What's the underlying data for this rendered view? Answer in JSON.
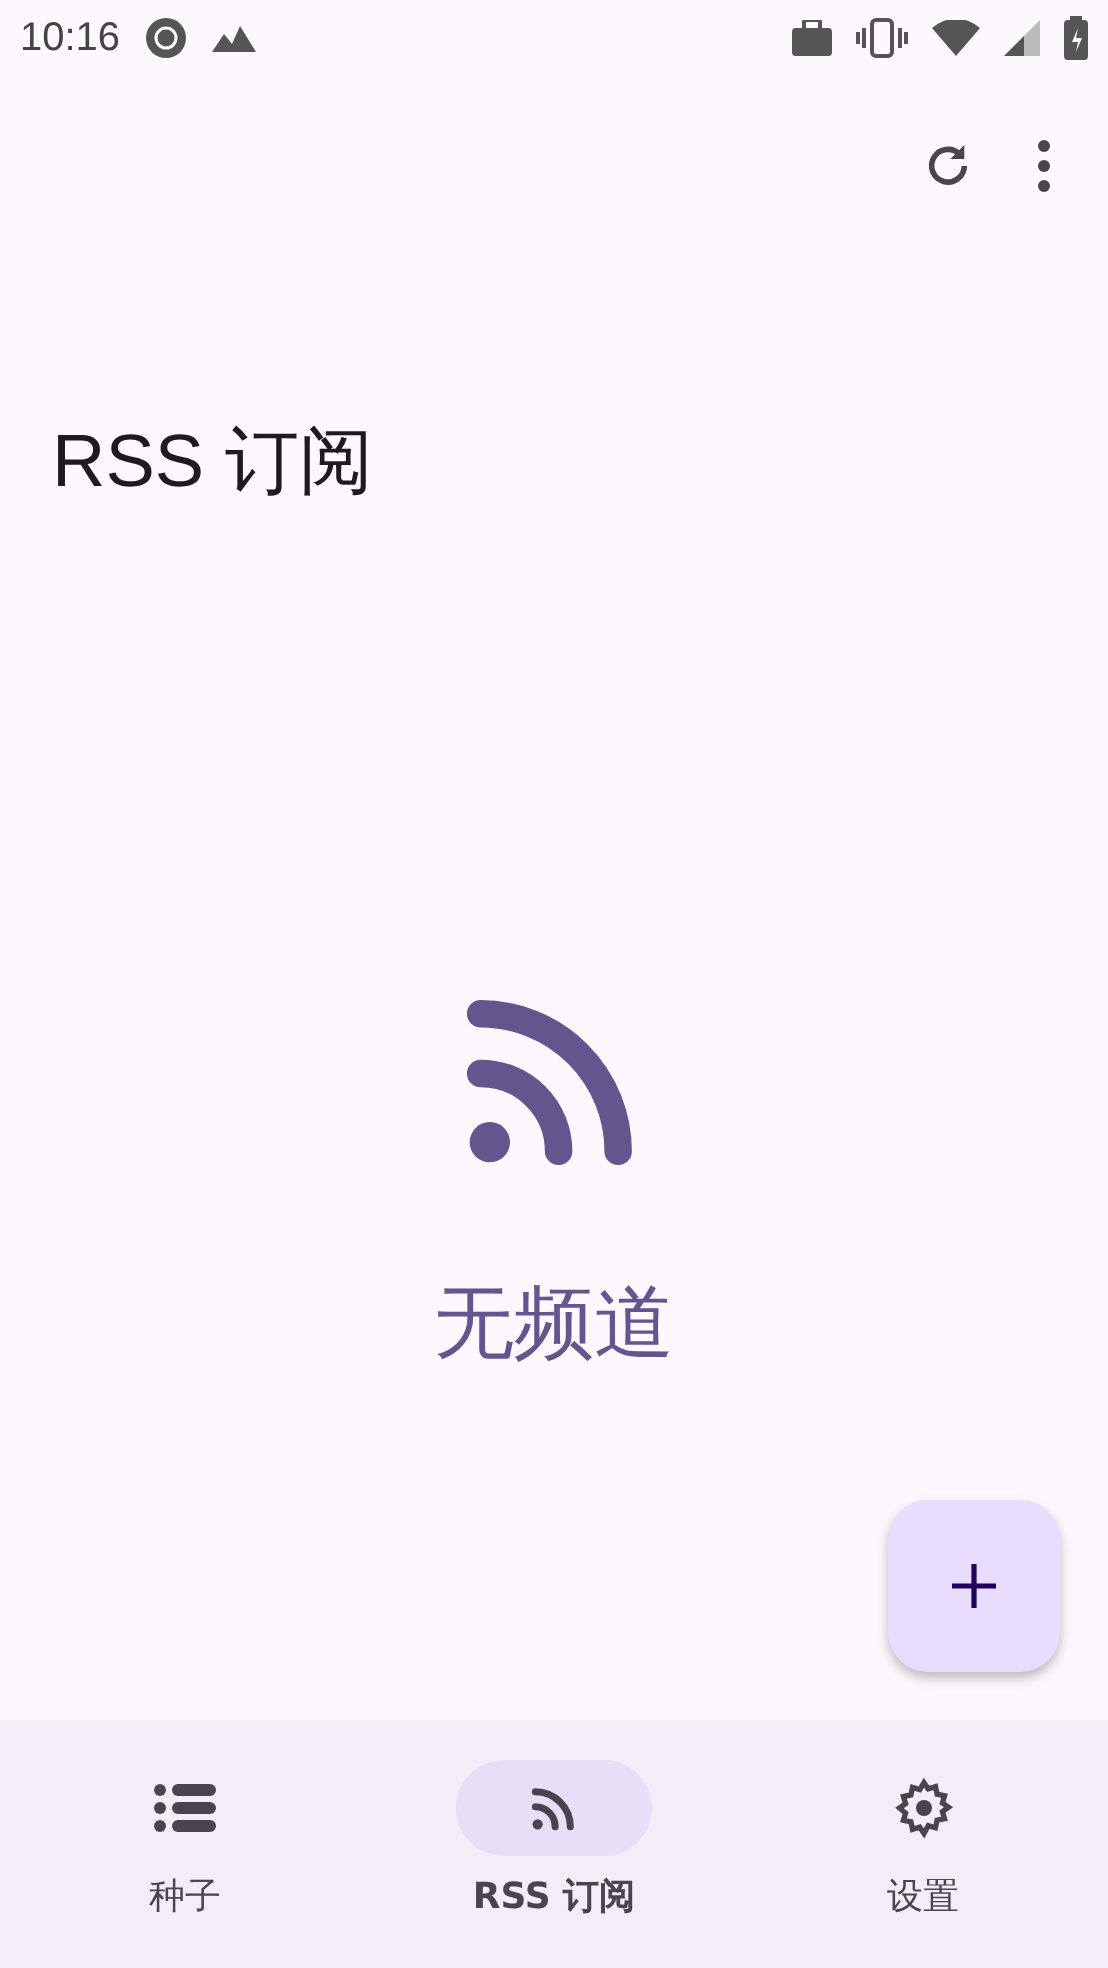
{
  "status_bar": {
    "time": "10:16"
  },
  "title": "RSS 订阅",
  "empty_state": {
    "message": "无频道"
  },
  "nav": [
    {
      "label": "种子",
      "kind": "list",
      "selected": false
    },
    {
      "label": "RSS 订阅",
      "kind": "rss",
      "selected": true
    },
    {
      "label": "设置",
      "kind": "settings",
      "selected": false
    }
  ]
}
